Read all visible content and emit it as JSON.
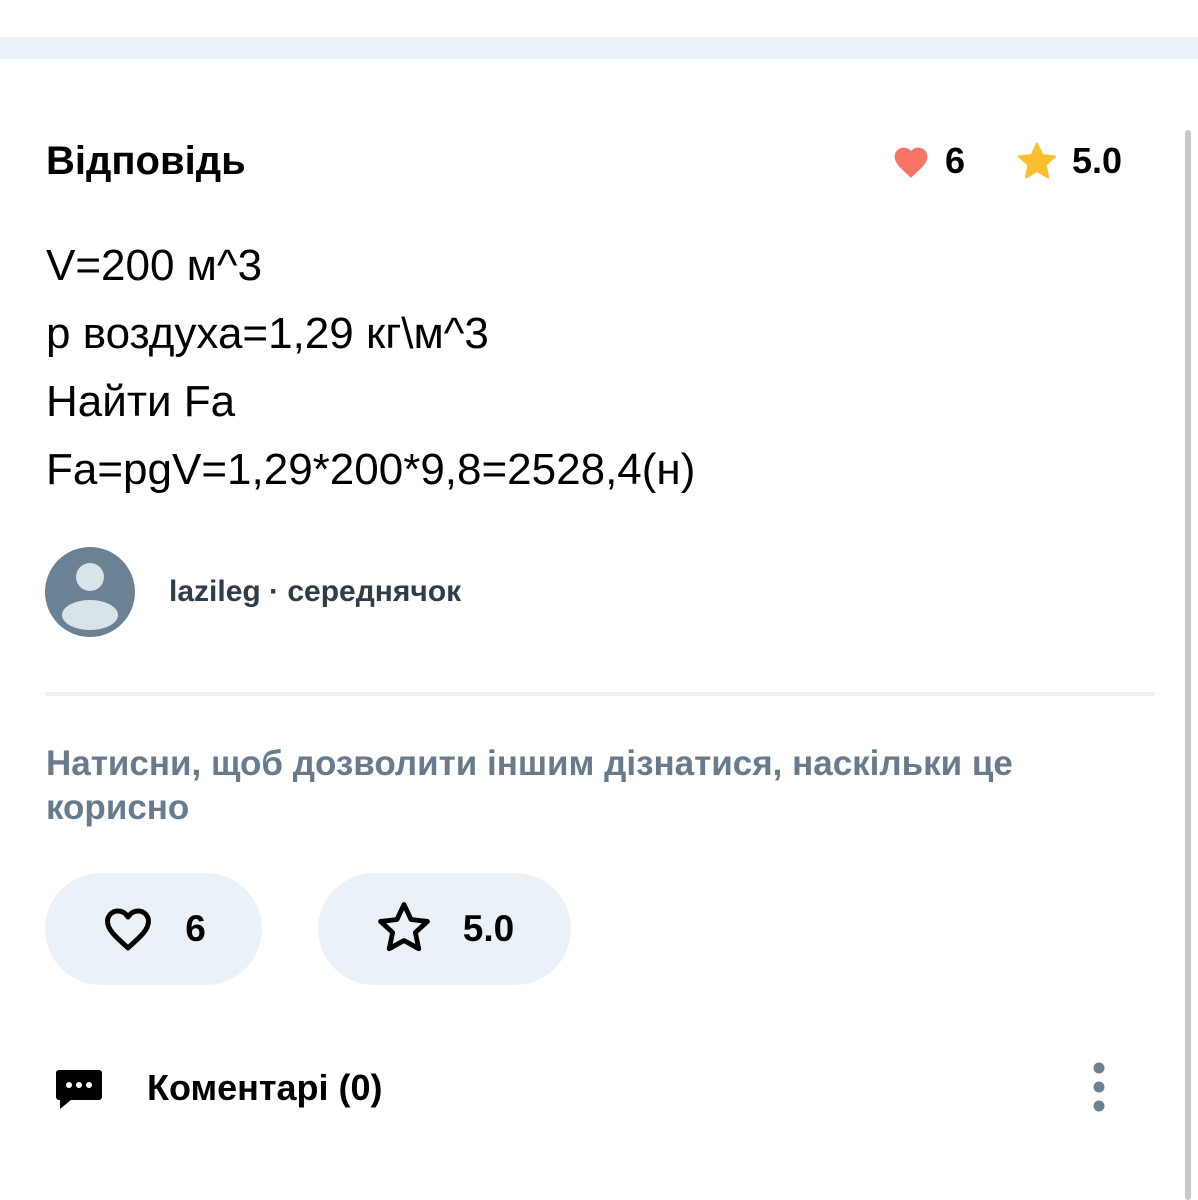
{
  "answer_header": {
    "title": "Відповідь",
    "likes": "6",
    "rating": "5.0"
  },
  "answer": {
    "lines": [
      "V=200 м^3",
      "p воздуха=1,29 кг\\м^3",
      "Найти Fa",
      "Fa=pgV=1,29*200*9,8=2528,4(н)"
    ]
  },
  "author": {
    "name_line": "lazileg · середнячок"
  },
  "feedback": {
    "prompt": "Натисни, щоб дозволити іншим дізнатися, наскільки це корисно",
    "like_count": "6",
    "rating_value": "5.0"
  },
  "comments": {
    "label": "Коментарі (0)"
  },
  "icons": {
    "header_like": "heart-icon",
    "header_rating": "star-icon",
    "avatar": "user-icon",
    "like_button": "heart-outline-icon",
    "rate_button": "star-outline-icon",
    "comments": "comment-bubble-icon",
    "menu": "more-vertical-icon"
  },
  "colors": {
    "heart": "#f77366",
    "star": "#fbbe2e",
    "avatar_bg": "#6b8194",
    "avatar_fg": "#d9e3ea",
    "muted_text": "#687b8c",
    "pill_bg": "#ebf2f7",
    "band": "#ebf2f7",
    "ink": "#000000"
  }
}
